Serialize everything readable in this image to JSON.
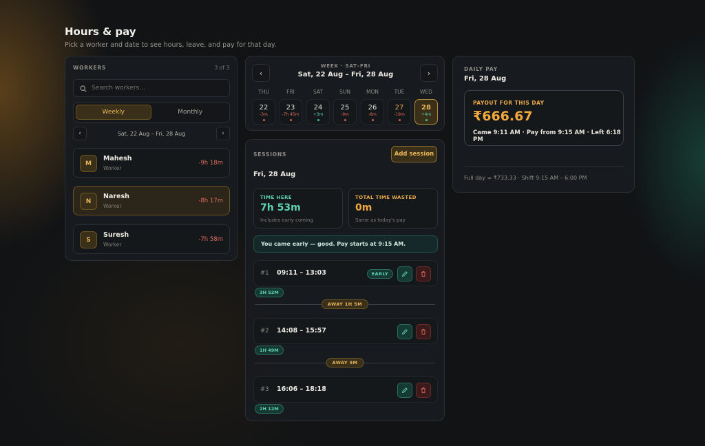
{
  "page": {
    "title": "Hours & pay",
    "subtitle": "Pick a worker and date to see hours, leave, and pay for that day."
  },
  "workers": {
    "heading": "WORKERS",
    "count": "3 of 3",
    "search_placeholder": "Search workers...",
    "toggle": {
      "weekly": "Weekly",
      "monthly": "Monthly",
      "selected": "weekly"
    },
    "prev": "‹",
    "next": "›",
    "range": "Sat, 22 Aug – Fri, 28 Aug",
    "list": [
      {
        "initial": "M",
        "name": "Mahesh",
        "role": "Worker",
        "delta": "-9h 18m"
      },
      {
        "initial": "N",
        "name": "Naresh",
        "role": "Worker",
        "delta": "-8h 17m",
        "selected": true
      },
      {
        "initial": "S",
        "name": "Suresh",
        "role": "Worker",
        "delta": "-7h 58m"
      }
    ]
  },
  "week": {
    "caption": "WEEK · SAT–FRI",
    "range": "Sat, 22 Aug – Fri, 28 Aug",
    "prev": "‹",
    "next": "›",
    "days": [
      {
        "name": "THU",
        "num": "22",
        "delta": "-3m",
        "dot": "#d65d52"
      },
      {
        "name": "FRI",
        "num": "23",
        "delta": "-7h 45m",
        "dot": "#d65d52"
      },
      {
        "name": "SAT",
        "num": "24",
        "delta": "+3m",
        "dot": "#3fc79a"
      },
      {
        "name": "SUN",
        "num": "25",
        "delta": "-9m",
        "dot": "#d65d52"
      },
      {
        "name": "MON",
        "num": "26",
        "delta": "-8m",
        "dot": "#d65d52"
      },
      {
        "name": "TUE",
        "num": "27",
        "delta": "-19m",
        "dot": "#d65d52"
      },
      {
        "name": "WED",
        "num": "28",
        "delta": "+4m",
        "dot": "#3fc79a",
        "selected": true
      }
    ]
  },
  "sessions": {
    "heading": "SESSIONS",
    "add_label": "Add session",
    "date": "Fri, 28 Aug",
    "time_here": {
      "caption": "TIME HERE",
      "value": "7h 53m",
      "note": "Includes early coming"
    },
    "time_wasted": {
      "caption": "TOTAL TIME WASTED",
      "value": "0m",
      "note": "Same as today's pay"
    },
    "banner": "You came early — good. Pay starts at 9:15 AM.",
    "items": [
      {
        "idx": "#1",
        "time": "09:11 – 13:03",
        "badge": "EARLY",
        "duration": "3H 52M",
        "away": "AWAY 1H 5M"
      },
      {
        "idx": "#2",
        "time": "14:08 – 15:57",
        "duration": "1H 49M",
        "away": "AWAY 9M"
      },
      {
        "idx": "#3",
        "time": "16:06 – 18:18",
        "duration": "2H 12M"
      }
    ]
  },
  "pay": {
    "heading": "DAILY PAY",
    "date": "Fri, 28 Aug",
    "payout_caption": "PAYOUT FOR THIS DAY",
    "amount": "₹666.67",
    "details": "Came 9:11 AM · Pay from 9:15 AM · Left 6:18 PM",
    "footer": "Full day = ₹733.33 · Shift 9:15 AM – 6:00 PM"
  },
  "colors": {
    "accent": "#e9b65a",
    "positive": "#5fd3b0",
    "negative": "#e06a5a",
    "background": "#111315"
  }
}
